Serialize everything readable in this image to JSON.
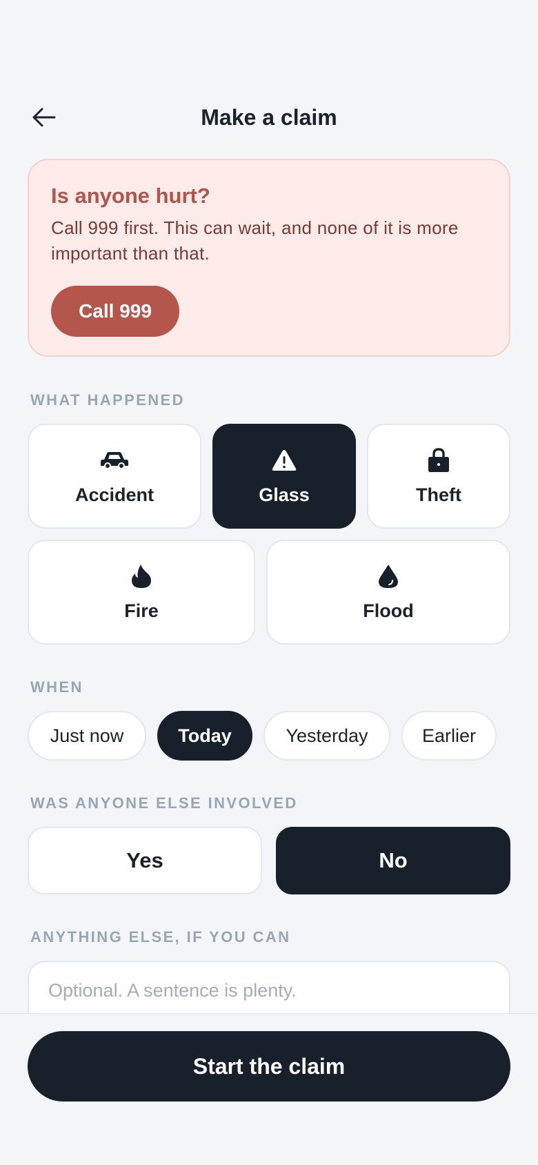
{
  "header": {
    "title": "Make a claim",
    "back_icon": "arrow-left-icon"
  },
  "alert": {
    "title": "Is anyone hurt?",
    "body": "Call 999 first. This can wait, and none of it is more important than that.",
    "button_label": "Call 999",
    "colors": {
      "background": "#fcebe8",
      "accent": "#b5564c"
    }
  },
  "what_happened": {
    "label": "WHAT HAPPENED",
    "selected": "Glass",
    "options": [
      {
        "label": "Accident",
        "icon": "car-icon"
      },
      {
        "label": "Glass",
        "icon": "warning-triangle-icon"
      },
      {
        "label": "Theft",
        "icon": "padlock-icon"
      },
      {
        "label": "Fire",
        "icon": "flame-icon"
      },
      {
        "label": "Flood",
        "icon": "water-drop-icon"
      }
    ]
  },
  "when": {
    "label": "WHEN",
    "selected": "Today",
    "options": [
      "Just now",
      "Today",
      "Yesterday",
      "Earlier"
    ]
  },
  "involved": {
    "label": "WAS ANYONE ELSE INVOLVED",
    "selected": "No",
    "options": [
      "Yes",
      "No"
    ]
  },
  "notes": {
    "label": "ANYTHING ELSE, IF YOU CAN",
    "placeholder": "Optional. A sentence is plenty.",
    "value": ""
  },
  "cta": {
    "label": "Start the claim"
  },
  "colors": {
    "dark": "#18212b",
    "page_bg": "#f3f5f8",
    "muted_label": "#98a6b4"
  }
}
